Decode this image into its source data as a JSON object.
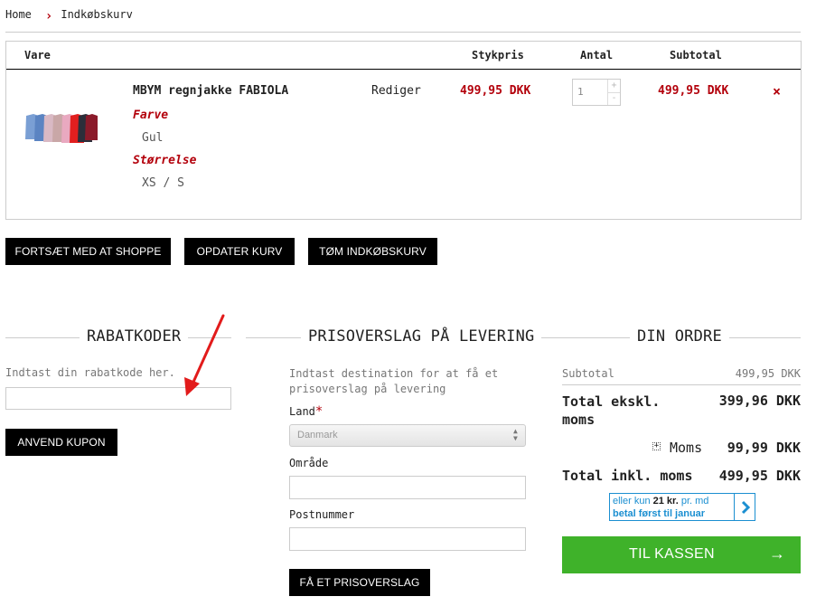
{
  "breadcrumb": {
    "home": "Home",
    "separator": "›",
    "current": "Indkøbskurv"
  },
  "table": {
    "headers": {
      "item": "Vare",
      "unit_price": "Stykpris",
      "qty": "Antal",
      "subtotal": "Subtotal"
    },
    "row": {
      "name": "MBYM regnjakke FABIOLA",
      "edit": "Rediger",
      "price": "499,95 DKK",
      "qty": "1",
      "subtotal": "499,95 DKK",
      "remove": "×",
      "attr1_label": "Farve",
      "attr1_value": "Gul",
      "attr2_label": "Størrelse",
      "attr2_value": "XS / S"
    }
  },
  "actions": {
    "continue": "FORTSÆT MED AT SHOPPE",
    "update": "OPDATER KURV",
    "empty": "TØM INDKØBSKURV"
  },
  "coupon": {
    "title": "RABATKODER",
    "hint": "Indtast din rabatkode her.",
    "apply": "ANVEND KUPON"
  },
  "shipping": {
    "title": "PRISOVERSLAG PÅ LEVERING",
    "hint": "Indtast destination for at få et prisoverslag på levering",
    "country_label": "Land",
    "required": "*",
    "country_value": "Danmark",
    "region_label": "Område",
    "zip_label": "Postnummer",
    "submit": "FÅ ET PRISOVERSLAG"
  },
  "order": {
    "title": "DIN ORDRE",
    "subtotal_label": "Subtotal",
    "subtotal_value": "499,95 DKK",
    "excl_label": "Total ekskl. moms",
    "excl_value": "399,96 DKK",
    "tax_label": "Moms",
    "tax_value": "99,99 DKK",
    "incl_label": "Total inkl. moms",
    "incl_value": "499,95 DKK",
    "promo_pre": "eller kun ",
    "promo_amount": "21 kr.",
    "promo_post": " pr. md",
    "promo_line2": "betal først til januar",
    "checkout": "TIL KASSEN",
    "checkout_arrow": "→"
  },
  "colors": {
    "accent_red": "#b3000b",
    "checkout_green": "#3fb22a",
    "arrow_red": "#e21b1b"
  }
}
